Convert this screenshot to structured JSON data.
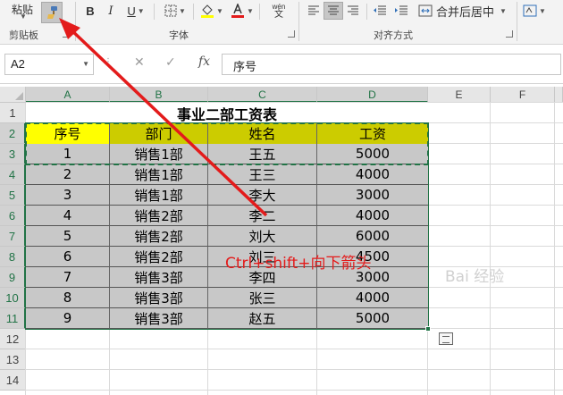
{
  "ribbon": {
    "clipboard": {
      "paste_label": "粘贴",
      "group_label": "剪贴板"
    },
    "font": {
      "bold_label": "B",
      "italic_label": "I",
      "underline_label": "U",
      "phonetic_label": "wén",
      "phonetic_sub": "文",
      "group_label": "字体",
      "highlight_color": "#ffff00",
      "font_color": "#e31b1b"
    },
    "alignment": {
      "merge_label": "合并后居中",
      "group_label": "对齐方式"
    }
  },
  "formula_bar": {
    "name_box": "A2",
    "content": "序号",
    "fx_label": "fx"
  },
  "sheet": {
    "columns": [
      "A",
      "B",
      "C",
      "D",
      "E",
      "F"
    ],
    "rows": [
      "1",
      "2",
      "3",
      "4",
      "5",
      "6",
      "7",
      "8",
      "9",
      "10",
      "11",
      "12",
      "13",
      "14"
    ],
    "title": "事业二部工资表",
    "headers": [
      "序号",
      "部门",
      "姓名",
      "工资"
    ],
    "data": [
      [
        "1",
        "销售1部",
        "王五",
        "5000"
      ],
      [
        "2",
        "销售1部",
        "王三",
        "4000"
      ],
      [
        "3",
        "销售1部",
        "李大",
        "3000"
      ],
      [
        "4",
        "销售2部",
        "李二",
        "4000"
      ],
      [
        "5",
        "销售2部",
        "刘大",
        "6000"
      ],
      [
        "6",
        "销售2部",
        "刘三",
        "4500"
      ],
      [
        "7",
        "销售3部",
        "李四",
        "3000"
      ],
      [
        "8",
        "销售3部",
        "张三",
        "4000"
      ],
      [
        "9",
        "销售3部",
        "赵五",
        "5000"
      ]
    ]
  },
  "annotation": "Ctrl+shift+向下箭头",
  "watermark": "Bai 经验",
  "colors": {
    "accent": "#217346",
    "header_fill": "#cccc00",
    "header_first_fill": "#ffff00",
    "body_fill": "#c8c8c8",
    "annotation": "#e31b1b"
  }
}
